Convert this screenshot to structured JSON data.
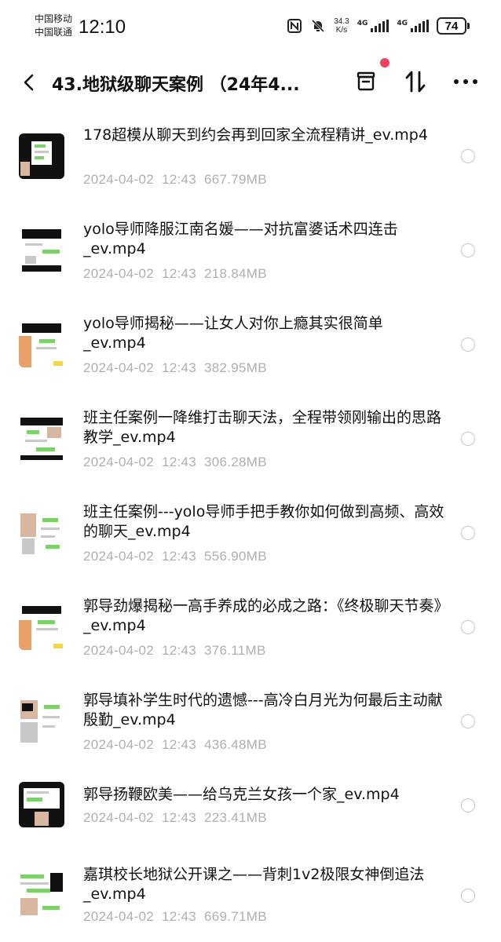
{
  "status_bar": {
    "carrier_1": "中国移动",
    "carrier_2": "中国联通",
    "time": "12:10",
    "speed_value": "34.3",
    "speed_unit": "K/s",
    "network_1": "4G",
    "network_2": "4G",
    "battery": "74",
    "icons": [
      "nfc-icon",
      "mute-bell-icon",
      "signal-icon",
      "signal-icon",
      "battery-icon"
    ]
  },
  "header": {
    "title": "43.地狱级聊天案例 （24年4...",
    "icons": [
      "back-icon",
      "archive-icon",
      "sort-icon",
      "more-icon"
    ],
    "notification_dot_color": "#f0425e"
  },
  "files": [
    {
      "name": "178超模从聊天到约会再到回家全流程精讲_ev.mp4",
      "date": "2024-04-02",
      "time": "12:43",
      "size": "667.79MB"
    },
    {
      "name": "yolo导师降服江南名媛——对抗富婆话术四连击_ev.mp4",
      "date": "2024-04-02",
      "time": "12:43",
      "size": "218.84MB"
    },
    {
      "name": "yolo导师揭秘——让女人对你上瘾其实很简单_ev.mp4",
      "date": "2024-04-02",
      "time": "12:43",
      "size": "382.95MB"
    },
    {
      "name": "班主任案例一降维打击聊天法，全程带领刚输出的思路教学_ev.mp4",
      "date": "2024-04-02",
      "time": "12:43",
      "size": "306.28MB"
    },
    {
      "name": "班主任案例---yolo导师手把手教你如何做到高频、高效的聊天_ev.mp4",
      "date": "2024-04-02",
      "time": "12:43",
      "size": "556.90MB"
    },
    {
      "name": "郭导劲爆揭秘一高手养成的必成之路：《终极聊天节奏》_ev.mp4",
      "date": "2024-04-02",
      "time": "12:43",
      "size": "376.11MB"
    },
    {
      "name": "郭导填补学生时代的遗憾---高冷白月光为何最后主动献殷勤_ev.mp4",
      "date": "2024-04-02",
      "time": "12:43",
      "size": "436.48MB"
    },
    {
      "name": "郭导扬鞭欧美——给乌克兰女孩一个家_ev.mp4",
      "date": "2024-04-02",
      "time": "12:43",
      "size": "223.41MB"
    },
    {
      "name": "嘉琪校长地狱公开课之——背刺1v2极限女神倒追法_ev.mp4",
      "date": "2024-04-02",
      "time": "12:43",
      "size": "669.71MB"
    }
  ]
}
